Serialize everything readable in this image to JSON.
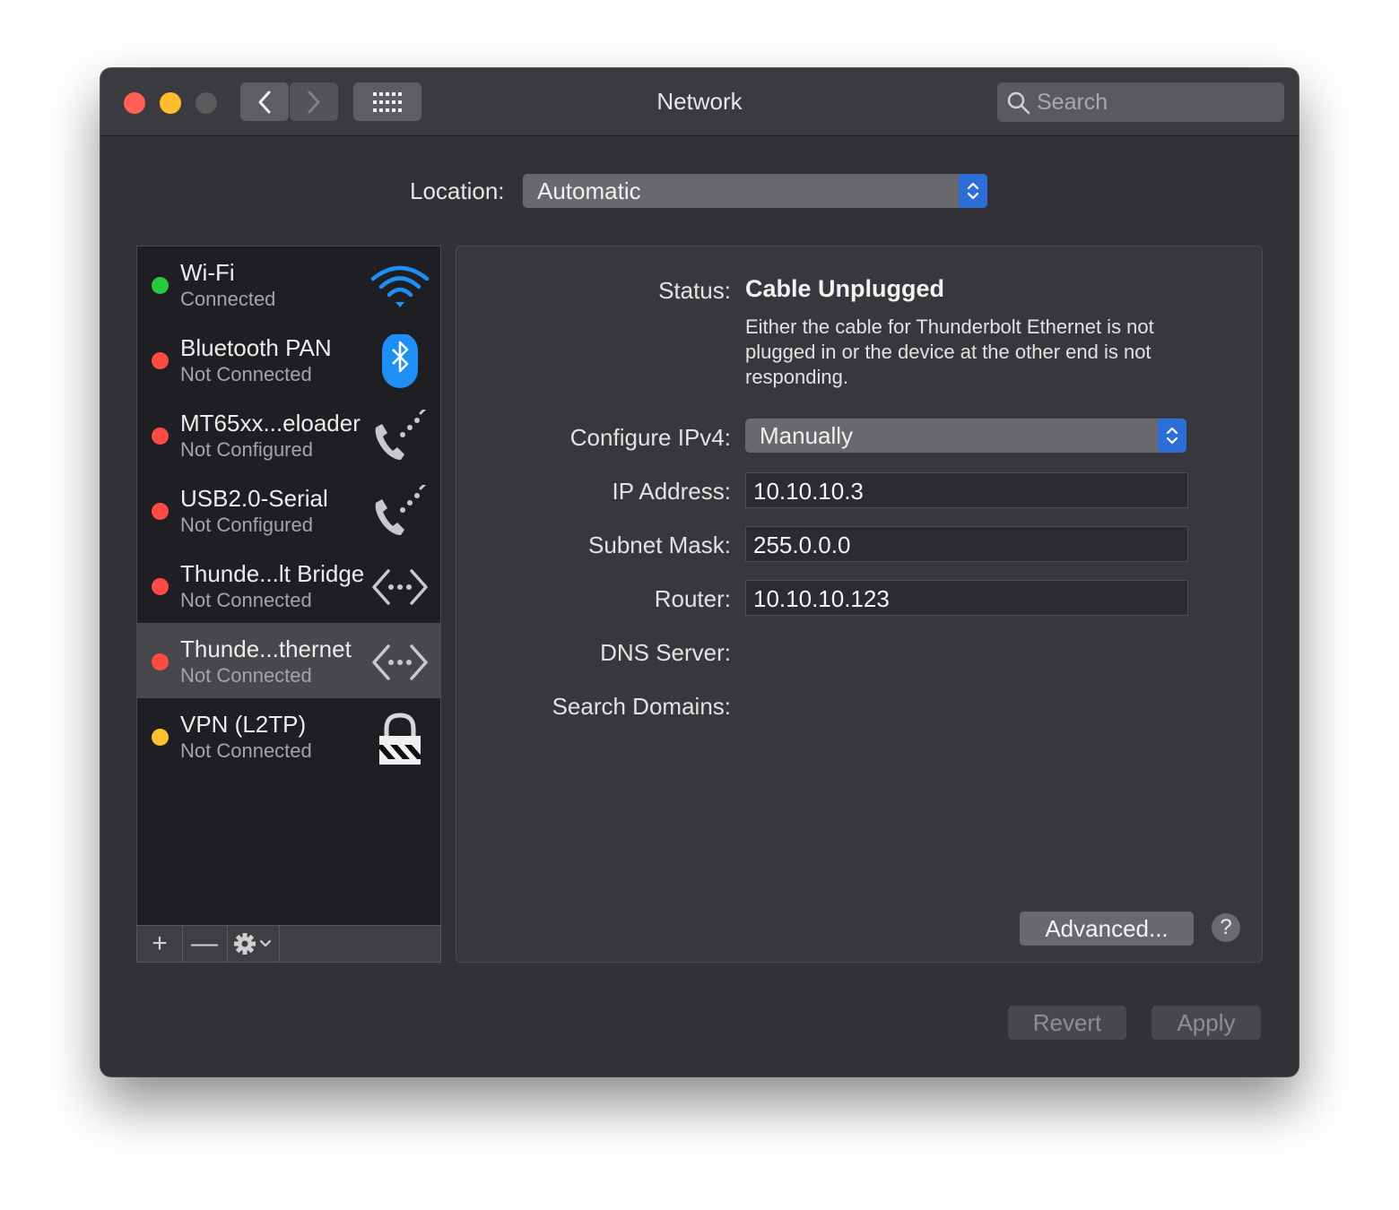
{
  "window": {
    "title": "Network",
    "search_placeholder": "Search"
  },
  "location": {
    "label": "Location:",
    "value": "Automatic"
  },
  "services": [
    {
      "name": "Wi-Fi",
      "status": "Connected",
      "status_color": "#2ac840",
      "icon": "wifi-icon"
    },
    {
      "name": "Bluetooth PAN",
      "status": "Not Connected",
      "status_color": "#fe4a45",
      "icon": "bluetooth-icon"
    },
    {
      "name": "MT65xx...eloader",
      "status": "Not Configured",
      "status_color": "#fe4a45",
      "icon": "phone-modem-icon"
    },
    {
      "name": "USB2.0-Serial",
      "status": "Not Configured",
      "status_color": "#fe4a45",
      "icon": "phone-modem-icon"
    },
    {
      "name": "Thunde...lt Bridge",
      "status": "Not Connected",
      "status_color": "#fe4a45",
      "icon": "ethernet-arrows-icon"
    },
    {
      "name": "Thunde...thernet",
      "status": "Not Connected",
      "status_color": "#fe4a45",
      "icon": "ethernet-arrows-icon",
      "selected": true
    },
    {
      "name": "VPN (L2TP)",
      "status": "Not Connected",
      "status_color": "#fec02e",
      "icon": "vpn-lock-icon"
    }
  ],
  "toolbar": {
    "add_label": "+",
    "remove_label": "—"
  },
  "detail": {
    "status_label": "Status:",
    "status_value": "Cable Unplugged",
    "status_description": "Either the cable for Thunderbolt Ethernet is not plugged in or the device at the other end is not responding.",
    "configure_label": "Configure IPv4:",
    "configure_value": "Manually",
    "ip_label": "IP Address:",
    "ip_value": "10.10.10.3",
    "subnet_label": "Subnet Mask:",
    "subnet_value": "255.0.0.0",
    "router_label": "Router:",
    "router_value": "10.10.10.123",
    "dns_label": "DNS Server:",
    "search_domains_label": "Search Domains:",
    "advanced_label": "Advanced...",
    "help_label": "?"
  },
  "footer": {
    "revert_label": "Revert",
    "apply_label": "Apply"
  },
  "colors": {
    "accent": "#2e6ed8"
  }
}
